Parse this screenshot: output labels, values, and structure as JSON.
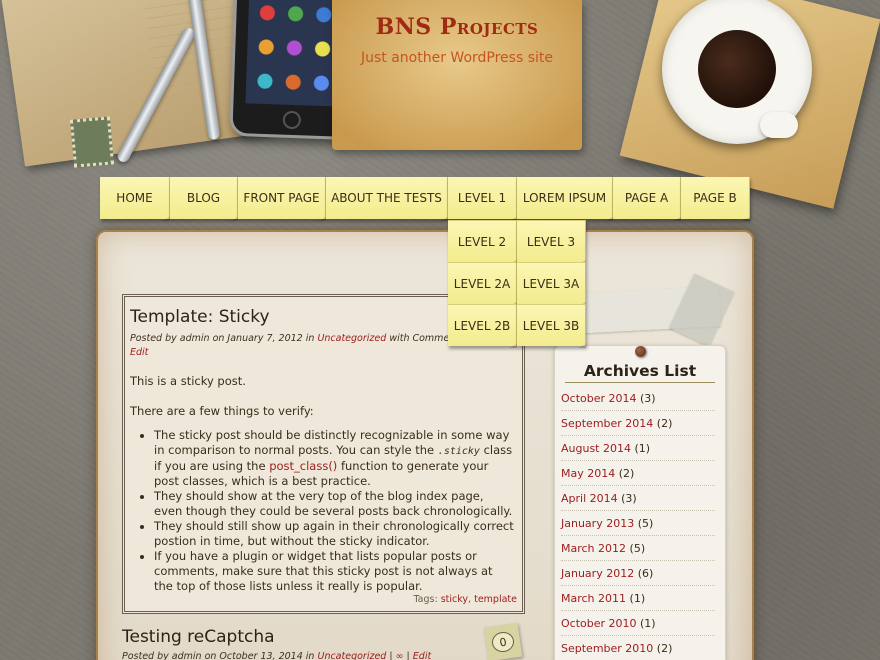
{
  "site": {
    "title": "BNS Projects",
    "tagline": "Just another WordPress site"
  },
  "nav": {
    "items": [
      {
        "label": "HOME"
      },
      {
        "label": "BLOG"
      },
      {
        "label": "FRONT PAGE"
      },
      {
        "label": "ABOUT THE TESTS"
      },
      {
        "label": "LEVEL 1"
      },
      {
        "label": "LOREM IPSUM"
      },
      {
        "label": "PAGE A"
      },
      {
        "label": "PAGE B"
      }
    ],
    "sub_col1": [
      {
        "label": "LEVEL 2"
      },
      {
        "label": "LEVEL 2A"
      },
      {
        "label": "LEVEL 2B"
      }
    ],
    "sub_col2": [
      {
        "label": "LEVEL 3"
      },
      {
        "label": "LEVEL 3A"
      },
      {
        "label": "LEVEL 3B"
      }
    ]
  },
  "post": {
    "title": "Template: Sticky",
    "meta_prefix": "Posted by admin on January 7, 2012 in",
    "category": "Uncategorized",
    "meta_suffix": "with Comments",
    "edit": "Edit",
    "intro": "This is a sticky post.",
    "verify": "There are a few things to verify:",
    "bullet1_a": "The sticky post should be distinctly recognizable in some way in comparison to normal posts. You can style the",
    "bullet1_code": ".sticky",
    "bullet1_b": "class if you are using the",
    "bullet1_link": "post_class()",
    "bullet1_c": "function to generate your post classes, which is a best practice.",
    "bullet2": "They should show at the very top of the blog index page, even though they could be several posts back chronologically.",
    "bullet3": "They should still show up again in their chronologically correct postion in time, but without the sticky indicator.",
    "bullet4": "If you have a plugin or widget that lists popular posts or comments, make sure that this sticky post is not always at the top of those lists unless it really is popular.",
    "tags_label": "Tags:",
    "tag1": "sticky",
    "tag_sep": ",",
    "tag2": "template"
  },
  "post2": {
    "title": "Testing reCaptcha",
    "meta_prefix": "Posted by admin on October 13, 2014 in",
    "category": "Uncategorized",
    "sep1": "|",
    "permalink": "∞",
    "sep2": "|",
    "edit": "Edit",
    "comments": "0"
  },
  "sidebar": {
    "archives_title": "Archives List",
    "archives": [
      {
        "month": "October 2014",
        "count": "(3)"
      },
      {
        "month": "September 2014",
        "count": "(2)"
      },
      {
        "month": "August 2014",
        "count": "(1)"
      },
      {
        "month": "May 2014",
        "count": "(2)"
      },
      {
        "month": "April 2014",
        "count": "(3)"
      },
      {
        "month": "January 2013",
        "count": "(5)"
      },
      {
        "month": "March 2012",
        "count": "(5)"
      },
      {
        "month": "January 2012",
        "count": "(6)"
      },
      {
        "month": "March 2011",
        "count": "(1)"
      },
      {
        "month": "October 2010",
        "count": "(1)"
      },
      {
        "month": "September 2010",
        "count": "(2)"
      }
    ]
  },
  "colors": {
    "title": "#a02a14",
    "tagline": "#c5551c",
    "link": "#9b1c1c",
    "nav_note": "#f3ec8e"
  }
}
